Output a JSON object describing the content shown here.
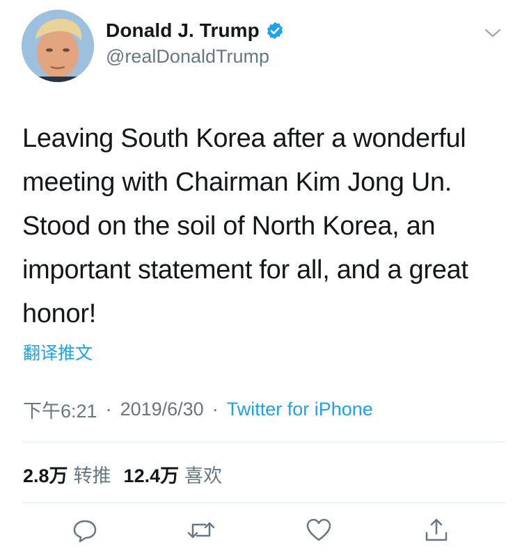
{
  "user": {
    "name": "Donald J. Trump",
    "handle": "@realDonaldTrump",
    "verified": true
  },
  "tweet": {
    "lines": [
      "Leaving South Korea after a wonderful",
      "meeting with Chairman Kim Jong Un.",
      "Stood on the soil of North Korea, an",
      "important statement for all, and a great",
      "honor!"
    ],
    "translate_label": "翻译推文"
  },
  "meta": {
    "time": "下午6:21",
    "separator": "·",
    "date": "2019/6/30",
    "source": "Twitter for iPhone"
  },
  "stats": {
    "retweets": "2.8万",
    "retweets_label": "转推",
    "likes": "12.4万",
    "likes_label": "喜欢"
  },
  "icons": {
    "more": "chevron-down-icon",
    "reply": "reply-icon",
    "retweet": "retweet-icon",
    "like": "heart-icon",
    "share": "share-icon",
    "verified": "verified-badge-icon"
  },
  "colors": {
    "accent": "#1da1f2",
    "muted": "#657786",
    "text": "#14171a"
  }
}
